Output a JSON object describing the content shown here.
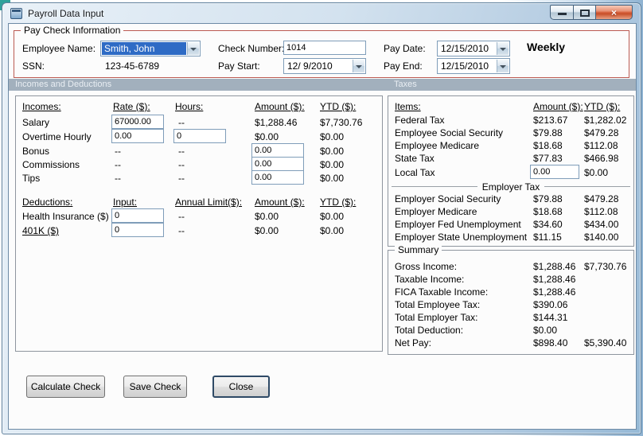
{
  "window": {
    "title": "Payroll Data Input",
    "close_glyph": "×"
  },
  "paycheck": {
    "legend": "Pay Check Information",
    "employee_name_label": "Employee Name:",
    "employee_name_value": "Smith, John",
    "ssn_label": "SSN:",
    "ssn_value": "123-45-6789",
    "check_number_label": "Check Number:",
    "check_number_value": "1014",
    "pay_start_label": "Pay Start:",
    "pay_start_value": "12/ 9/2010",
    "pay_date_label": "Pay Date:",
    "pay_date_value": "12/15/2010",
    "pay_end_label": "Pay End:",
    "pay_end_value": "12/15/2010",
    "frequency": "Weekly"
  },
  "sections": {
    "incomes_deductions": "Incomes and Deductions",
    "taxes": "Taxes"
  },
  "incomes": {
    "headers": {
      "incomes": "Incomes:",
      "rate": "Rate ($):",
      "hours": "Hours:",
      "amount": "Amount ($):",
      "ytd": "YTD ($):"
    },
    "salary": {
      "label": "Salary",
      "rate": "67000.00",
      "hours": "--",
      "amount": "$1,288.46",
      "ytd": "$7,730.76"
    },
    "overtime": {
      "label": "Overtime Hourly",
      "rate": "0.00",
      "hours": "0",
      "amount": "$0.00",
      "ytd": "$0.00"
    },
    "bonus": {
      "label": "Bonus",
      "rate": "--",
      "hours": "--",
      "amount": "0.00",
      "ytd": "$0.00"
    },
    "commissions": {
      "label": "Commissions",
      "rate": "--",
      "hours": "--",
      "amount": "0.00",
      "ytd": "$0.00"
    },
    "tips": {
      "label": "Tips",
      "rate": "--",
      "hours": "--",
      "amount": "0.00",
      "ytd": "$0.00"
    }
  },
  "deductions": {
    "headers": {
      "deductions": "Deductions:",
      "input": "Input:",
      "limit": "Annual Limit($):",
      "amount": "Amount ($):",
      "ytd": "YTD ($):"
    },
    "health_insurance": {
      "label": "Health Insurance  ($)",
      "input": "0",
      "limit": "--",
      "amount": "$0.00",
      "ytd": "$0.00"
    },
    "k401": {
      "label": "401K  ($)",
      "input": "0",
      "limit": "--",
      "amount": "$0.00",
      "ytd": "$0.00"
    }
  },
  "taxes": {
    "headers": {
      "items": "Items:",
      "amount": "Amount ($):",
      "ytd": "YTD ($):"
    },
    "federal": {
      "label": "Federal Tax",
      "amount": "$213.67",
      "ytd": "$1,282.02"
    },
    "employee_ss": {
      "label": "Employee Social Security",
      "amount": "$79.88",
      "ytd": "$479.28"
    },
    "employee_medicare": {
      "label": "Employee Medicare",
      "amount": "$18.68",
      "ytd": "$112.08"
    },
    "state": {
      "label": "State Tax",
      "amount": "$77.83",
      "ytd": "$466.98"
    },
    "local": {
      "label": "Local Tax",
      "amount": "0.00",
      "ytd": "$0.00"
    },
    "employer_header": "Employer Tax",
    "employer_ss": {
      "label": "Employer Social Security",
      "amount": "$79.88",
      "ytd": "$479.28"
    },
    "employer_medicare": {
      "label": "Employer Medicare",
      "amount": "$18.68",
      "ytd": "$112.08"
    },
    "employer_fed_unemployment": {
      "label": "Employer Fed Unemployment",
      "amount": "$34.60",
      "ytd": "$434.00"
    },
    "employer_state_unemployment": {
      "label": "Employer State Unemployment",
      "amount": "$11.15",
      "ytd": "$140.00"
    }
  },
  "summary": {
    "legend": "Summary",
    "gross_income": {
      "label": "Gross Income:",
      "current": "$1,288.46",
      "ytd": "$7,730.76"
    },
    "taxable_income": {
      "label": "Taxable Income:",
      "current": "$1,288.46",
      "ytd": ""
    },
    "fica_taxable_income": {
      "label": "FICA Taxable Income:",
      "current": "$1,288.46",
      "ytd": ""
    },
    "total_employee_tax": {
      "label": "Total Employee Tax:",
      "current": "$390.06",
      "ytd": ""
    },
    "total_employer_tax": {
      "label": "Total Employer Tax:",
      "current": "$144.31",
      "ytd": ""
    },
    "total_deduction": {
      "label": "Total Deduction:",
      "current": "$0.00",
      "ytd": ""
    },
    "net_pay": {
      "label": "Net Pay:",
      "current": "$898.40",
      "ytd": "$5,390.40"
    }
  },
  "buttons": {
    "calculate": "Calculate Check",
    "save": "Save Check",
    "close": "Close"
  }
}
